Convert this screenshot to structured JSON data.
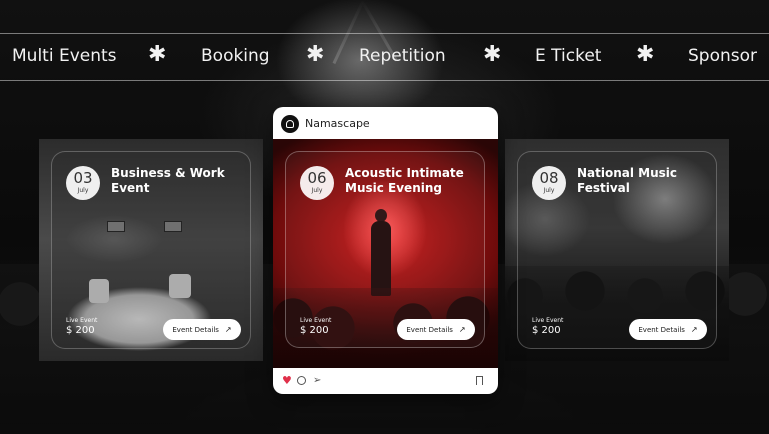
{
  "marquee": {
    "items": [
      "Multi Events",
      "Booking",
      "Repetition",
      "E Ticket",
      "Sponsor"
    ],
    "separator": "✱"
  },
  "center_card": {
    "brand": "Namascape",
    "day": "06",
    "month": "July",
    "title": "Acoustic Intimate Music Evening",
    "live_label": "Live Event",
    "price": "$ 200",
    "button": "Event Details",
    "liked": true
  },
  "left_card": {
    "day": "03",
    "month": "July",
    "title": "Business & Work Event",
    "live_label": "Live Event",
    "price": "$ 200",
    "button": "Event Details"
  },
  "right_card": {
    "day": "08",
    "month": "July",
    "title": "National Music Festival",
    "live_label": "Live Event",
    "price": "$ 200",
    "button": "Event Details"
  },
  "colors": {
    "heart": "#e0304a",
    "stage_red": "#c81818"
  },
  "icons": {
    "button_arrow": "arrow-up-right-icon",
    "like": "heart-icon",
    "comment": "comment-icon",
    "share": "send-icon",
    "save": "bookmark-icon"
  }
}
